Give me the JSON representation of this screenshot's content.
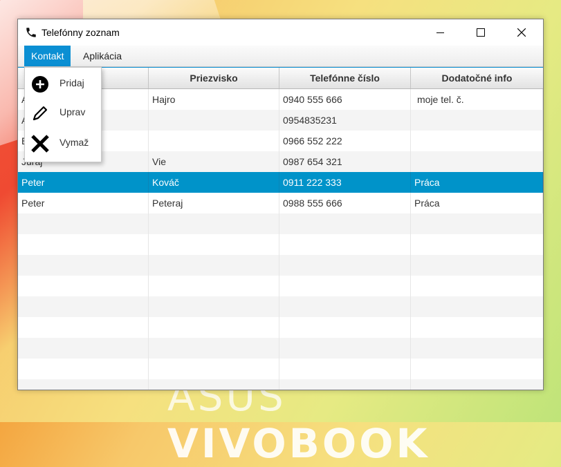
{
  "window": {
    "title": "Telefónny zoznam",
    "icon": "phone-icon"
  },
  "menubar": {
    "items": [
      {
        "label": "Kontakt",
        "active": true
      },
      {
        "label": "Aplikácia",
        "active": false
      }
    ]
  },
  "context_menu": {
    "items": [
      {
        "label": "Pridaj",
        "icon": "add-circle-icon"
      },
      {
        "label": "Uprav",
        "icon": "pencil-icon"
      },
      {
        "label": "Vymaž",
        "icon": "x-mark-icon"
      }
    ]
  },
  "table": {
    "columns": [
      "",
      "Priezvisko",
      "Telefónne číslo",
      "Dodatočné info"
    ],
    "rows": [
      [
        "A",
        "Hajro",
        "0940 555 666",
        "moje tel. č."
      ],
      [
        "A",
        "",
        "0954835231",
        ""
      ],
      [
        "E",
        "",
        "0966 552 222",
        ""
      ],
      [
        "Juraj",
        "Vie",
        "0987 654 321",
        ""
      ],
      [
        "Peter",
        "Kováč",
        "0911 222 333",
        "Práca"
      ],
      [
        "Peter",
        "Peteraj",
        "0988 555 666",
        "Práca"
      ]
    ],
    "selected_row": 4,
    "accent_color": "#0093c9"
  },
  "wallpaper": {
    "text_thin": "ASUS",
    "text_bold": "VIVOBOOK"
  }
}
